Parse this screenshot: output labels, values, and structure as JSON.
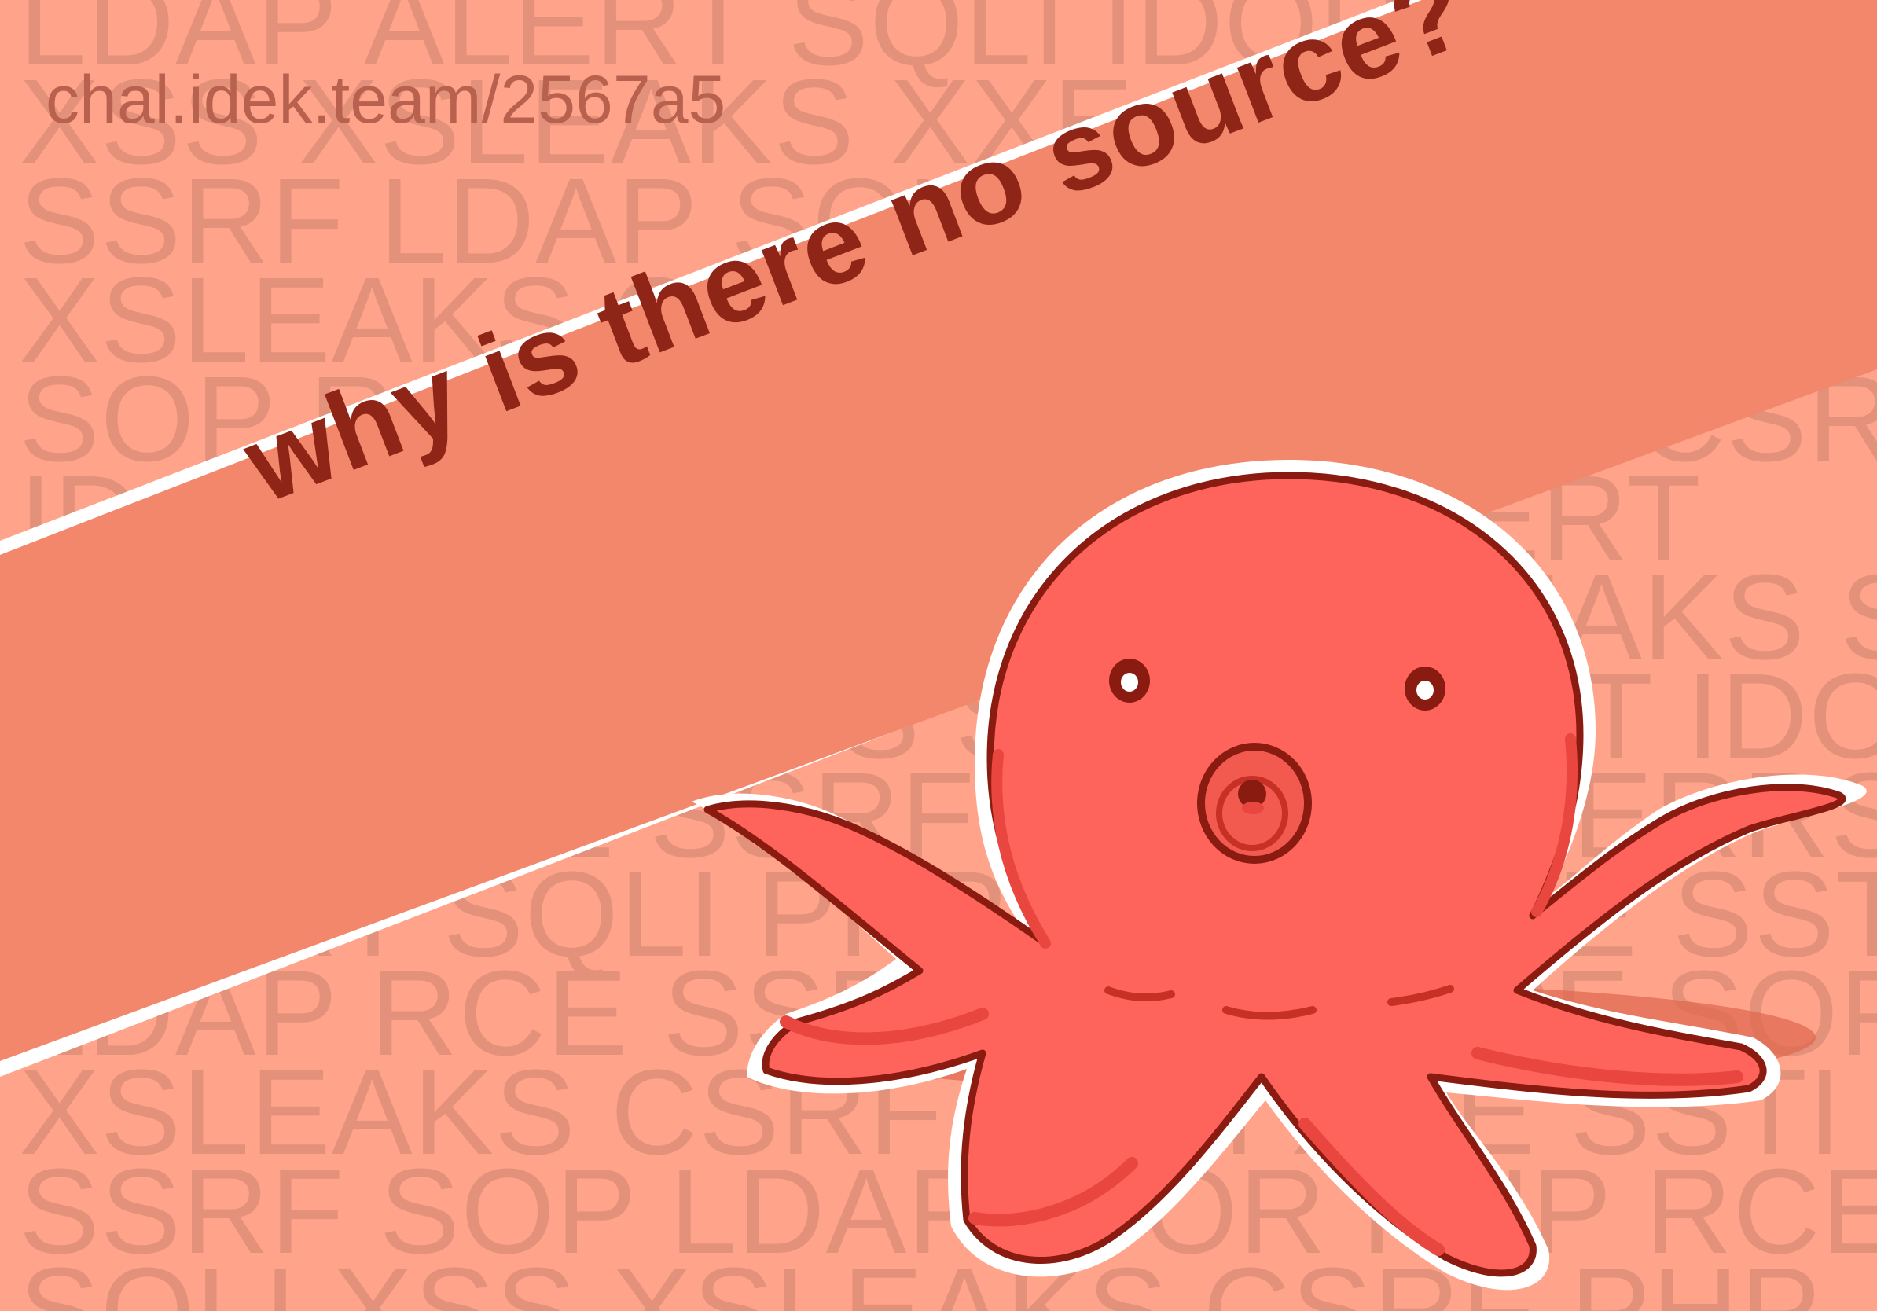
{
  "url_text": "chal.idek.team/2567a5",
  "headline": "why is there no source?",
  "background_words": [
    "LDAP ALERT SQLI IDOR SSTI XSS CSRF",
    "XSS XSLEAKS XXE SSRF LDAP SOP",
    "SSRF LDAP SQLI XSS ALERT RCE",
    "XSLEAKS CSRF PHP SSTI LDAP",
    "SOP RCE IDOR XXE ALERT CSRF CS",
    "IDOR SSRF PHP SQLI ALERT",
    "RCE SSTI LDAP XXE XSLEAKS SO",
    "CSRF SOP XSS SQLI ALERT IDO",
    "LDAP XXE SSRF PHP XSS ERRS",
    "ALERT SQLI PHP IDOR RCE SSTI",
    "LDAP RCE SSRF XXE SSRF SOP R",
    "XSLEAKS CSRF SQLI XXE SSTI X",
    "SSRF SOP LDAP IDOR PHP RCE",
    "SQLI XSS XSLEAKS CSRF PHP"
  ],
  "colors": {
    "background": "#ffa48a",
    "background_words": "#e3917a",
    "banner": "#f2876c",
    "banner_edge": "#ffffff",
    "headline": "#8f2516",
    "url": "#b8614f",
    "octopus_body": "#ff645c",
    "octopus_outline": "#8a1b10",
    "octopus_shade": "#e8463f"
  },
  "icons": [
    "octopus-illustration"
  ]
}
